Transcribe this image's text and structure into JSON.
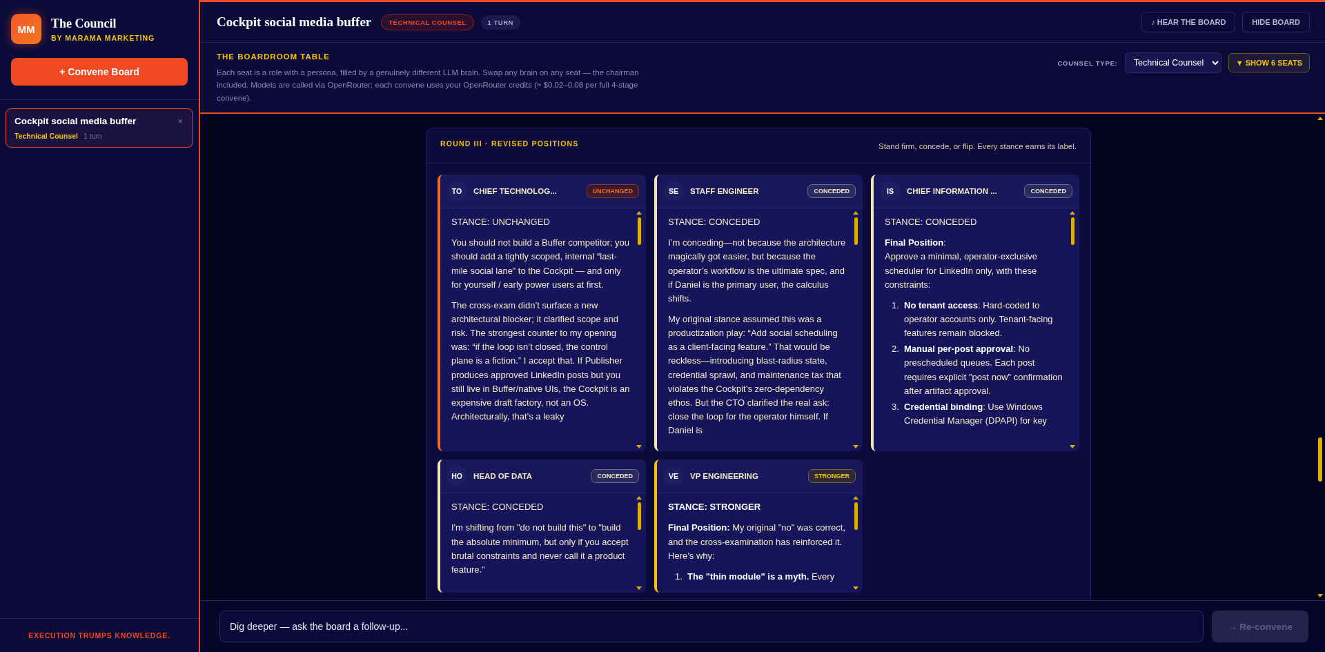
{
  "sidebar": {
    "logo": {
      "initials": "MM",
      "title": "The Council",
      "subtitle": "BY MARAMA MARKETING"
    },
    "convene_button": "+ Convene Board",
    "sessions": [
      {
        "title": "Cockpit social media buffer",
        "counsel": "Technical Counsel",
        "turns": "1 turn",
        "close": "×",
        "selected": true
      }
    ],
    "footer": "EXECUTION TRUMPS KNOWLEDGE."
  },
  "header": {
    "title": "Cockpit social media buffer",
    "badges": [
      {
        "text": "TECHNICAL COUNSEL",
        "kind": "counsel"
      },
      {
        "text": "1 TURN",
        "kind": "count"
      }
    ],
    "buttons": [
      "♪ HEAR THE BOARD",
      "HIDE BOARD"
    ]
  },
  "boardroom": {
    "heading": "THE BOARDROOM TABLE",
    "description": "Each seat is a role with a persona, filled by a genuinely different LLM brain. Swap any brain on any seat — the chairman included. Models are called via OpenRouter; each convene uses your OpenRouter credits (≈ $0.02–0.08 per full 4-stage convene).",
    "counsel_type": {
      "label": "COUNSEL TYPE:",
      "value": "Technical Counsel"
    },
    "seats_button": "▼ SHOW 6 SEATS"
  },
  "round": {
    "title": "ROUND III · REVISED POSITIONS",
    "subtitle": "Stand firm, concede, or flip. Every stance earns its label.",
    "seats": [
      {
        "initials": "TO",
        "title": "CHIEF TECHNOLOG...",
        "kind": "unchanged",
        "badge": "UNCHANGED",
        "blocks": [
          {
            "kind": "stance",
            "text": "STANCE: UNCHANGED"
          },
          {
            "kind": "paragraph",
            "text": "You should not build a Buffer competitor; you should add a tightly scoped, internal “last-mile social lane” to the Cockpit — and only for yourself / early power users at first."
          },
          {
            "kind": "paragraph",
            "text": "The cross-exam didn’t surface a new architectural blocker; it clarified scope and risk. The strongest counter to my opening was: “if the loop isn’t closed, the control plane is a fiction.” I accept that. If Publisher produces approved LinkedIn posts but you still live in Buffer/native UIs, the Cockpit is an expensive draft factory, not an OS. Architecturally, that’s a leaky"
          }
        ]
      },
      {
        "initials": "SE",
        "title": "STAFF ENGINEER",
        "kind": "conceded",
        "badge": "CONCEDED",
        "blocks": [
          {
            "kind": "stance",
            "text": "STANCE: CONCEDED"
          },
          {
            "kind": "paragraph",
            "text": "I’m conceding—not because the architecture magically got easier, but because the operator’s workflow is the ultimate spec, and if Daniel is the primary user, the calculus shifts."
          },
          {
            "kind": "paragraph",
            "text": "My original stance assumed this was a productization play: “Add social scheduling as a client-facing feature.” That would be reckless—introducing blast-radius state, credential sprawl, and maintenance tax that violates the Cockpit’s zero-dependency ethos. But the CTO clarified the real ask: close the loop for the operator himself. If Daniel is"
          }
        ]
      },
      {
        "initials": "IS",
        "title": "CHIEF INFORMATION ...",
        "kind": "conceded",
        "badge": "CONCEDED",
        "blocks": [
          {
            "kind": "stance",
            "text": "STANCE: CONCEDED"
          },
          {
            "kind": "paragraph",
            "text": "**Final Position**:\nApprove a minimal, operator-exclusive scheduler for LinkedIn only, with these constraints:"
          },
          {
            "kind": "list",
            "items": [
              {
                "number": "1.",
                "text": "**No tenant access**: Hard-coded to operator accounts only. Tenant-facing features remain blocked."
              },
              {
                "number": "2.",
                "text": "**Manual per-post approval**: No prescheduled queues. Each post requires explicit \"post now\" confirmation after artifact approval."
              },
              {
                "number": "3.",
                "text": "**Credential binding**: Use Windows Credential Manager (DPAPI) for key"
              }
            ]
          }
        ]
      },
      {
        "initials": "HO",
        "title": "HEAD OF DATA",
        "kind": "conceded",
        "badge": "CONCEDED",
        "blocks": [
          {
            "kind": "stance",
            "text": "STANCE: CONCEDED"
          },
          {
            "kind": "paragraph",
            "text": "I'm shifting from \"do not build this\" to \"build the absolute minimum, but only if you accept brutal constraints and never call it a product feature.\""
          }
        ]
      },
      {
        "initials": "VE",
        "title": "VP ENGINEERING",
        "kind": "stronger",
        "badge": "STRONGER",
        "blocks": [
          {
            "kind": "heading",
            "text": "STANCE: STRONGER"
          },
          {
            "kind": "paragraph",
            "text": "**Final Position:** My original \"no\" was correct, and the cross-examination has reinforced it. Here’s why:"
          },
          {
            "kind": "list",
            "items": [
              {
                "number": "1.",
                "text": "**The \"thin module\" is a myth.** Every"
              }
            ]
          }
        ]
      }
    ]
  },
  "composer": {
    "placeholder": "Dig deeper — ask the board a follow-up...",
    "button": {
      "label": "→ Re-convene",
      "disabled": true
    }
  }
}
